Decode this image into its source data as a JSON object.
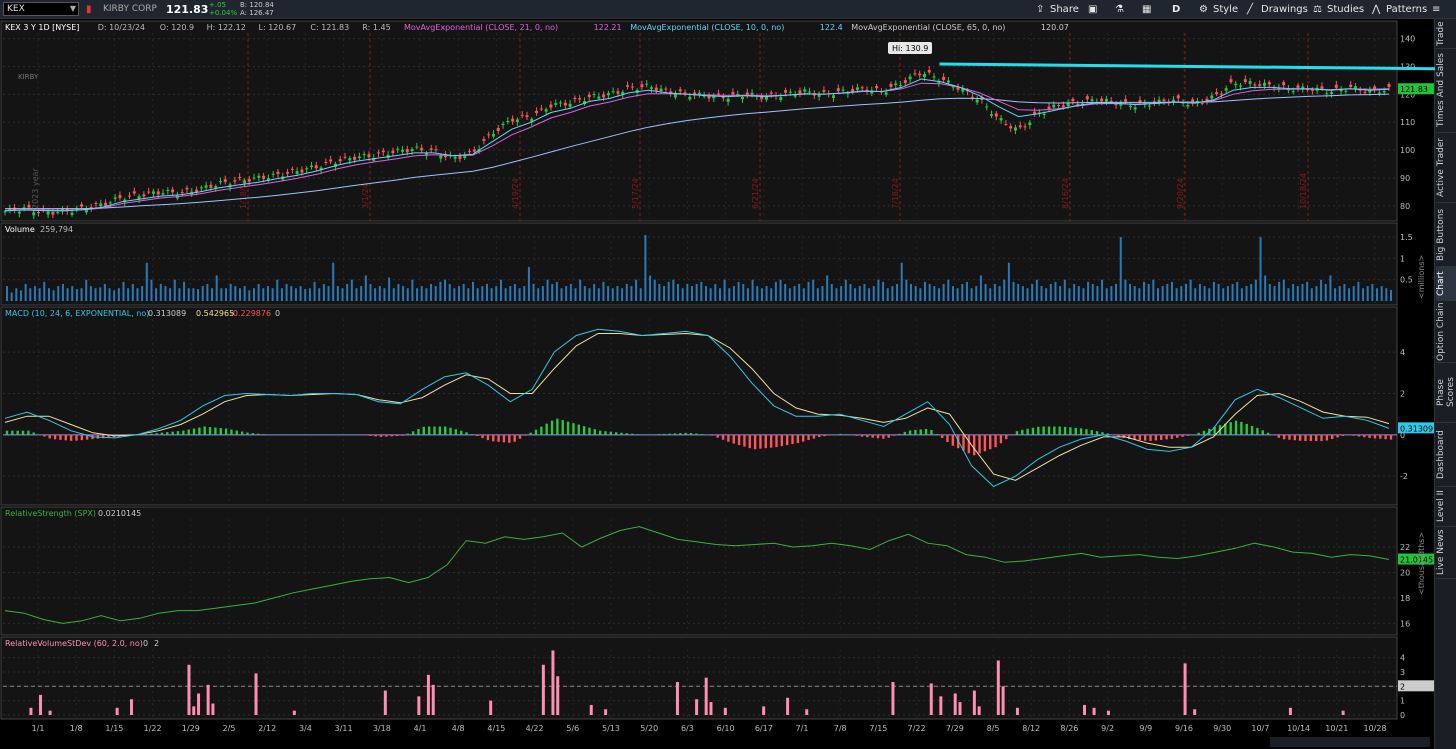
{
  "toolbar": {
    "symbol_input": "KEX",
    "company": "KIRBY CORP",
    "last": "121.83",
    "change": "+.05",
    "change_pct": "+0.04%",
    "bid": "B: 120.84",
    "ask": "A: 126.47",
    "share": "Share",
    "timeframe": "D",
    "style": "Style",
    "drawings": "Drawings",
    "studies": "Studies",
    "patterns": "Patterns"
  },
  "sidebar": [
    "Trade",
    "Times And Sales",
    "Active Trader",
    "Big Buttons",
    "Chart",
    "Option Chain",
    "Phase Scores",
    "Dashboard",
    "Level II",
    "Live News"
  ],
  "price_header": {
    "title": "KEX 3 Y 1D [NYSE]",
    "date": "D: 10/23/24",
    "open": "O: 120.9",
    "high": "H: 122.12",
    "low": "L: 120.67",
    "close": "C: 121.83",
    "range": "R: 1.45",
    "ema21_label": "MovAvgExponential (CLOSE, 21, 0, no)",
    "ema21_val": "122.21",
    "ema10_label": "MovAvgExponential (CLOSE, 10, 0, no)",
    "ema10_val": "122.4",
    "ema65_label": "MovAvgExponential (CLOSE, 65, 0, no)",
    "ema65_val": "120.07"
  },
  "annotations": {
    "hi_label": "Hi: 130.9",
    "year_label": "2023 year",
    "date_markers": [
      "1/18/24",
      "3/1/24",
      "4/19/24",
      "5/17/24",
      "6/21/24",
      "7/18/24",
      "8/16/24",
      "9/20/24",
      "10/18/24"
    ],
    "logo": "KIRBY"
  },
  "volume_header": {
    "title": "Volume",
    "value": "259,794",
    "units": "<millions>"
  },
  "macd_header": {
    "title": "MACD (10, 24, 6, EXPONENTIAL, no)",
    "value": "0.313089",
    "avg": "0.542965",
    "diff": "-0.229876",
    "extra": "0",
    "last_tag": "0.31309"
  },
  "rs_header": {
    "title": "RelativeStrength (SPX)",
    "value": "0.0210145",
    "last_tag": "21.0145",
    "units": "<thousandths>"
  },
  "rvs_header": {
    "title": "RelativeVolumeStDev (60, 2.0, no)",
    "value": "0",
    "threshold": "2",
    "last_tag": "2"
  },
  "colors": {
    "up": "#27c93f",
    "down": "#ff5555",
    "ema10": "#5fd7ff",
    "ema21": "#e060e0",
    "ema65": "#a0c0ff",
    "volume": "#2a7ab8",
    "macd": "#30c8e8",
    "macd_avg": "#f0e0a0",
    "rs": "#3cb043",
    "rvs": "#ff8fb0",
    "trend": "#20e0f0"
  },
  "chart_data": [
    {
      "type": "candlestick",
      "title": "KEX 3 Y 1D [NYSE]",
      "y_ticks": [
        80,
        90,
        100,
        110,
        120,
        130,
        140
      ],
      "ylim": [
        76,
        142
      ],
      "last_value_tag": "121.83",
      "x_ticks": [
        "1/1",
        "1/8",
        "1/15",
        "1/22",
        "1/29",
        "2/5",
        "2/12",
        "3/4",
        "3/11",
        "3/18",
        "4/1",
        "4/8",
        "4/15",
        "4/22",
        "5/6",
        "5/13",
        "5/20",
        "6/3",
        "6/10",
        "6/17",
        "7/1",
        "7/8",
        "7/15",
        "7/22",
        "7/29",
        "8/5",
        "8/12",
        "8/26",
        "9/2",
        "9/9",
        "9/16",
        "9/30",
        "10/7",
        "10/14",
        "10/21",
        "10/28"
      ],
      "close_path": [
        78,
        79,
        77.5,
        78,
        79,
        80.5,
        83,
        84,
        85,
        84.5,
        86,
        88,
        89,
        90,
        91,
        92.5,
        94,
        96,
        97.5,
        98,
        99.5,
        100.5,
        99.5,
        97,
        99,
        106,
        111,
        112,
        116,
        117,
        119,
        120,
        122,
        123,
        121,
        120,
        119.5,
        119,
        120,
        119,
        120,
        121,
        120,
        121,
        122,
        121,
        124,
        128,
        125.5,
        122,
        118,
        111,
        107,
        113,
        116,
        117,
        118,
        117,
        116,
        117,
        118,
        116.5,
        119,
        124,
        124,
        123,
        122,
        122,
        121,
        122.5,
        121,
        121.8
      ],
      "ema10_path": [
        78.2,
        78.5,
        78.3,
        78.2,
        78.6,
        79.5,
        81.5,
        82.5,
        83.5,
        84,
        85,
        86.5,
        87.5,
        88.5,
        89.8,
        91,
        92.5,
        94.5,
        96,
        97,
        98,
        99,
        99,
        98,
        98.5,
        103,
        107.5,
        110,
        113.5,
        115,
        117.5,
        118.5,
        120.5,
        121.5,
        120.5,
        120,
        119.5,
        119.2,
        119.5,
        119.2,
        119.6,
        120.2,
        120,
        120.5,
        121.2,
        121,
        122.5,
        125.5,
        124.5,
        122.5,
        119.5,
        115.5,
        112,
        113,
        114.5,
        116,
        117,
        116.8,
        116.3,
        116.7,
        117.3,
        116.8,
        118,
        121.5,
        122.5,
        122.5,
        122,
        122,
        121.5,
        122,
        121.5,
        121.8
      ],
      "ema21_path": [
        78.4,
        78.6,
        78.5,
        78.4,
        78.6,
        79.2,
        80.8,
        81.8,
        82.8,
        83.4,
        84.3,
        85.6,
        86.6,
        87.6,
        88.7,
        89.9,
        91.3,
        93.2,
        94.7,
        95.8,
        96.8,
        97.9,
        98.3,
        98,
        98.2,
        101.5,
        105.5,
        108.3,
        111.5,
        113.5,
        115.8,
        117.2,
        119,
        120.2,
        120.2,
        120,
        119.8,
        119.6,
        119.7,
        119.5,
        119.7,
        120.1,
        120.1,
        120.4,
        121,
        121,
        122,
        124,
        123.8,
        122.5,
        120.5,
        117.5,
        114.5,
        114.3,
        114.8,
        115.8,
        116.6,
        116.7,
        116.5,
        116.7,
        117.1,
        117,
        117.7,
        120,
        121.3,
        121.8,
        121.8,
        121.9,
        121.7,
        122,
        121.8,
        122
      ],
      "ema65_path": [
        79,
        79,
        79,
        79,
        79,
        79.2,
        79.6,
        80,
        80.4,
        80.8,
        81.3,
        81.9,
        82.5,
        83.1,
        83.8,
        84.6,
        85.4,
        86.4,
        87.4,
        88.3,
        89.2,
        90.2,
        91,
        91.7,
        92.4,
        93.8,
        95.6,
        97.4,
        99.3,
        101.2,
        103,
        104.8,
        106.6,
        108.2,
        109.5,
        110.6,
        111.5,
        112.3,
        113,
        113.6,
        114.2,
        114.8,
        115.3,
        115.8,
        116.3,
        116.7,
        117.2,
        117.9,
        118.4,
        118.6,
        118.5,
        118,
        117.3,
        117,
        116.9,
        117,
        117.1,
        117.1,
        117.1,
        117.1,
        117.2,
        117.2,
        117.3,
        117.8,
        118.3,
        118.7,
        119,
        119.3,
        119.5,
        119.8,
        119.9,
        120.07
      ],
      "high_marker": 130.9,
      "trendline": [
        {
          "x": 0.575,
          "y": 130.9
        },
        {
          "x": 0.92,
          "y": 127.6
        }
      ]
    },
    {
      "type": "bar",
      "title": "Volume",
      "units": "millions",
      "y_ticks": [
        0.5,
        1,
        1.5
      ],
      "ylim": [
        0,
        1.55
      ],
      "values": [
        0.35,
        0.2,
        0.3,
        0.25,
        0.4,
        0.3,
        0.35,
        0.3,
        0.45,
        0.3,
        0.25,
        0.35,
        0.4,
        0.3,
        0.35,
        0.28,
        0.3,
        0.5,
        0.35,
        0.3,
        0.32,
        0.4,
        0.3,
        0.25,
        0.3,
        0.45,
        0.3,
        0.4,
        0.3,
        0.35,
        0.9,
        0.5,
        0.3,
        0.4,
        0.35,
        0.3,
        0.5,
        0.3,
        0.45,
        0.3,
        0.3,
        0.28,
        0.35,
        0.4,
        0.3,
        0.6,
        0.3,
        0.3,
        0.4,
        0.35,
        0.3,
        0.35,
        0.25,
        0.3,
        0.4,
        0.3,
        0.35,
        0.3,
        0.5,
        0.3,
        0.4,
        0.35,
        0.3,
        0.35,
        0.28,
        0.3,
        0.45,
        0.3,
        0.4,
        0.35,
        0.9,
        0.35,
        0.3,
        0.4,
        0.5,
        0.3,
        0.35,
        0.6,
        0.4,
        0.3,
        0.35,
        0.3,
        0.55,
        0.3,
        0.4,
        0.35,
        0.3,
        0.5,
        0.3,
        0.35,
        0.3,
        0.4,
        0.35,
        0.45,
        0.5,
        0.4,
        0.3,
        0.35,
        0.4,
        0.3,
        0.45,
        0.3,
        0.35,
        0.4,
        0.3,
        0.35,
        0.5,
        0.3,
        0.35,
        0.4,
        0.3,
        0.35,
        0.8,
        0.4,
        0.3,
        0.35,
        0.5,
        0.4,
        0.45,
        0.3,
        0.35,
        0.4,
        0.3,
        0.5,
        0.35,
        0.3,
        0.4,
        0.3,
        0.45,
        0.35,
        0.3,
        0.35,
        0.3,
        0.4,
        0.35,
        0.5,
        0.3,
        1.55,
        0.6,
        0.5,
        0.4,
        0.35,
        0.45,
        0.5,
        0.4,
        0.3,
        0.4,
        0.35,
        0.4,
        0.45,
        0.35,
        0.3,
        0.4,
        0.3,
        0.5,
        0.3,
        0.35,
        0.45,
        0.4,
        0.3,
        0.5,
        0.35,
        0.3,
        0.35,
        0.3,
        0.45,
        0.5,
        0.4,
        0.3,
        0.35,
        0.4,
        0.3,
        0.45,
        0.5,
        0.3,
        0.35,
        0.6,
        0.4,
        0.3,
        0.35,
        0.5,
        0.4,
        0.3,
        0.35,
        0.4,
        0.3,
        0.35,
        0.5,
        0.45,
        0.3,
        0.35,
        0.4,
        0.9,
        0.5,
        0.4,
        0.35,
        0.3,
        0.45,
        0.4,
        0.35,
        0.3,
        0.4,
        0.5,
        0.35,
        0.3,
        0.4,
        0.45,
        0.3,
        0.35,
        0.6,
        0.4,
        0.3,
        0.4,
        0.35,
        0.5,
        0.9,
        0.45,
        0.4,
        0.35,
        0.3,
        0.4,
        0.5,
        0.35,
        0.3,
        0.4,
        0.45,
        0.35,
        0.5,
        0.3,
        0.4,
        0.35,
        0.3,
        0.45,
        0.4,
        0.35,
        0.5,
        0.3,
        0.35,
        0.4,
        1.5,
        0.5,
        0.4,
        0.35,
        0.3,
        0.45,
        0.4,
        0.5,
        0.3,
        0.35,
        0.4,
        0.45,
        0.3,
        0.35,
        0.4,
        0.5,
        0.3,
        0.4,
        0.35,
        0.3,
        0.45,
        0.4,
        0.3,
        0.35,
        0.4,
        0.45,
        0.3,
        0.35,
        0.4,
        0.5,
        1.5,
        0.6,
        0.4,
        0.35,
        0.45,
        0.5,
        0.3,
        0.4,
        0.35,
        0.4,
        0.45,
        0.3,
        0.35,
        0.5,
        0.4,
        0.6,
        0.3,
        0.35,
        0.4,
        0.3,
        0.35,
        0.45,
        0.3,
        0.35,
        0.4,
        0.3,
        0.35,
        0.3,
        0.26
      ]
    },
    {
      "type": "line",
      "title": "MACD (10, 24, 6, EXPONENTIAL, no)",
      "y_ticks": [
        -2,
        0,
        2,
        4
      ],
      "ylim": [
        -3.2,
        5.6
      ],
      "macd_path": [
        0.8,
        1.1,
        0.7,
        0.2,
        -0.1,
        -0.15,
        0,
        0.3,
        0.7,
        1.4,
        1.9,
        2,
        1.95,
        1.9,
        2,
        2,
        1.95,
        1.6,
        1.5,
        2.2,
        2.8,
        3,
        2.4,
        1.6,
        2.2,
        4,
        4.8,
        5.1,
        5,
        4.8,
        4.9,
        5,
        4.8,
        3.8,
        2.5,
        1.4,
        0.9,
        0.9,
        1,
        0.7,
        0.4,
        1,
        1.6,
        0.5,
        -1.5,
        -2.5,
        -2,
        -1.2,
        -0.6,
        -0.2,
        0,
        -0.3,
        -0.7,
        -0.8,
        -0.6,
        0.3,
        1.7,
        2.2,
        1.8,
        1.3,
        0.8,
        0.9,
        0.7,
        0.31
      ],
      "avg_path": [
        0.6,
        0.9,
        0.9,
        0.5,
        0.1,
        -0.05,
        0,
        0.2,
        0.5,
        1,
        1.6,
        1.9,
        1.95,
        1.9,
        1.95,
        2,
        1.95,
        1.7,
        1.55,
        1.8,
        2.4,
        2.9,
        2.7,
        2,
        2,
        3.2,
        4.3,
        4.9,
        4.9,
        4.8,
        4.85,
        4.9,
        4.8,
        4.2,
        3.2,
        2,
        1.3,
        1,
        0.95,
        0.8,
        0.6,
        0.8,
        1.3,
        1,
        -0.5,
        -1.9,
        -2.2,
        -1.6,
        -1,
        -0.5,
        -0.1,
        -0.1,
        -0.4,
        -0.6,
        -0.6,
        -0.1,
        1,
        1.9,
        2,
        1.6,
        1.1,
        0.9,
        0.85,
        0.54
      ],
      "hist_path": [
        0.2,
        0.2,
        -0.2,
        -0.3,
        -0.2,
        -0.1,
        0,
        0.1,
        0.2,
        0.4,
        0.3,
        0.1,
        0,
        0,
        0,
        0,
        0,
        -0.1,
        -0.05,
        0.4,
        0.4,
        0.1,
        -0.3,
        -0.4,
        0.2,
        0.8,
        0.5,
        0.2,
        0.1,
        0,
        0.05,
        0.1,
        0,
        -0.4,
        -0.7,
        -0.6,
        -0.4,
        -0.1,
        0.05,
        -0.1,
        -0.2,
        0.2,
        0.3,
        -0.5,
        -1,
        -0.6,
        0.2,
        0.4,
        0.4,
        0.3,
        0.1,
        -0.2,
        -0.3,
        -0.2,
        0,
        0.4,
        0.7,
        0.3,
        -0.2,
        -0.3,
        -0.3,
        0,
        -0.15,
        -0.23
      ],
      "last_value_tag": "0.31309"
    },
    {
      "type": "line",
      "title": "RelativeStrength (SPX)",
      "units": "thousandths",
      "y_ticks": [
        16,
        18,
        20,
        22
      ],
      "ylim": [
        15.4,
        24.2
      ],
      "values": [
        17,
        16.8,
        16.3,
        16,
        16.2,
        16.6,
        16.2,
        16.4,
        16.8,
        17,
        17,
        17.2,
        17.4,
        17.6,
        18,
        18.4,
        18.7,
        19,
        19.3,
        19.5,
        19.6,
        19.2,
        19.6,
        20.6,
        22.5,
        22.3,
        22.8,
        22.6,
        22.8,
        23.1,
        22,
        22.7,
        23.3,
        23.6,
        23.1,
        22.6,
        22.4,
        22.2,
        22.1,
        22.2,
        22.3,
        22,
        22.1,
        22.3,
        22.1,
        21.8,
        22.5,
        23,
        22.3,
        22.1,
        21.4,
        21.2,
        20.8,
        20.9,
        21.1,
        21.3,
        21.5,
        21.2,
        21.3,
        21.4,
        21.2,
        21.1,
        21.3,
        21.6,
        21.9,
        22.3,
        22,
        21.6,
        21.5,
        21.2,
        21.4,
        21.3,
        21.0145
      ],
      "last_value_tag": "21.0145"
    },
    {
      "type": "bar",
      "title": "RelativeVolumeStDev (60, 2.0, no)",
      "y_ticks": [
        0,
        1,
        2,
        3,
        4
      ],
      "ylim": [
        0,
        4.6
      ],
      "threshold": 2,
      "bars": [
        {
          "i": 5,
          "v": 0.5
        },
        {
          "i": 7,
          "v": 1.4
        },
        {
          "i": 9,
          "v": 0.3
        },
        {
          "i": 23,
          "v": 0.5
        },
        {
          "i": 26,
          "v": 1.1
        },
        {
          "i": 38,
          "v": 3.5
        },
        {
          "i": 39,
          "v": 0.6
        },
        {
          "i": 40,
          "v": 1.5
        },
        {
          "i": 42,
          "v": 2.1
        },
        {
          "i": 43,
          "v": 0.8
        },
        {
          "i": 52,
          "v": 2.9
        },
        {
          "i": 60,
          "v": 0.3
        },
        {
          "i": 79,
          "v": 1.7
        },
        {
          "i": 86,
          "v": 1.3
        },
        {
          "i": 88,
          "v": 2.8
        },
        {
          "i": 89,
          "v": 2.1
        },
        {
          "i": 101,
          "v": 1.0
        },
        {
          "i": 112,
          "v": 3.5
        },
        {
          "i": 114,
          "v": 4.5
        },
        {
          "i": 115,
          "v": 2.7
        },
        {
          "i": 122,
          "v": 0.7
        },
        {
          "i": 125,
          "v": 0.4
        },
        {
          "i": 140,
          "v": 2.3
        },
        {
          "i": 144,
          "v": 1.1
        },
        {
          "i": 146,
          "v": 2.6
        },
        {
          "i": 147,
          "v": 0.9
        },
        {
          "i": 150,
          "v": 0.5
        },
        {
          "i": 158,
          "v": 0.6
        },
        {
          "i": 163,
          "v": 1.2
        },
        {
          "i": 167,
          "v": 0.4
        },
        {
          "i": 185,
          "v": 2.3
        },
        {
          "i": 193,
          "v": 2.2
        },
        {
          "i": 195,
          "v": 1.3
        },
        {
          "i": 198,
          "v": 1.5
        },
        {
          "i": 199,
          "v": 0.9
        },
        {
          "i": 202,
          "v": 1.7
        },
        {
          "i": 203,
          "v": 0.6
        },
        {
          "i": 207,
          "v": 3.8
        },
        {
          "i": 208,
          "v": 2.0
        },
        {
          "i": 211,
          "v": 0.5
        },
        {
          "i": 225,
          "v": 0.7
        },
        {
          "i": 227,
          "v": 0.5
        },
        {
          "i": 230,
          "v": 0.3
        },
        {
          "i": 246,
          "v": 3.6
        },
        {
          "i": 248,
          "v": 0.4
        },
        {
          "i": 268,
          "v": 0.5
        },
        {
          "i": 279,
          "v": 0.3
        }
      ],
      "bar_slots": 290,
      "last_value_tag": "2"
    }
  ]
}
